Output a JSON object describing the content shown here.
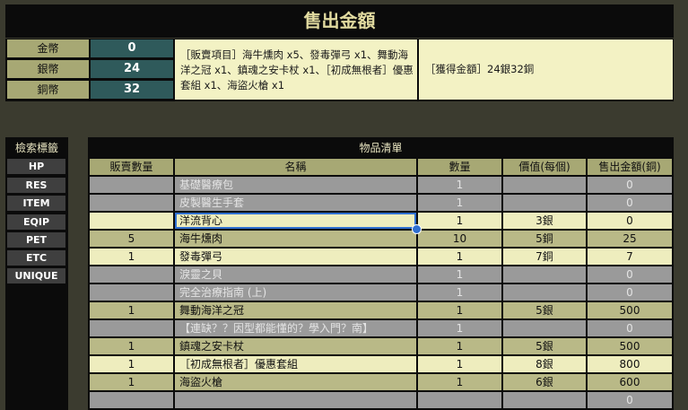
{
  "title": "售出金額",
  "coins": [
    {
      "label": "金幣",
      "value": "0"
    },
    {
      "label": "銀幣",
      "value": "24"
    },
    {
      "label": "銅幣",
      "value": "32"
    }
  ],
  "sold_items_text": "［販賣項目］海牛燻肉 x5、發毒彈弓 x1、舞動海洋之冠 x1、鎮魂之安卡杖 x1、［初成無根者］優惠套組 x1、海盜火槍 x1",
  "earned_text": "［獲得金額］24銀32銅",
  "sidebar": {
    "title": "檢索標籤",
    "buttons": [
      "HP",
      "RES",
      "ITEM",
      "EQIP",
      "PET",
      "ETC",
      "UNIQUE"
    ]
  },
  "table": {
    "title": "物品清單",
    "headers": [
      "販賣數量",
      "名稱",
      "數量",
      "價值(每個)",
      "售出金額(銅)"
    ],
    "rows": [
      {
        "sell": "",
        "name": "基礎醫療包",
        "qty": "1",
        "price": "",
        "total": "0",
        "style": "gray"
      },
      {
        "sell": "",
        "name": "皮製醫生手套",
        "qty": "1",
        "price": "",
        "total": "0",
        "style": "gray"
      },
      {
        "sell": "",
        "name": "洋流背心",
        "qty": "1",
        "price": "3銀",
        "total": "0",
        "style": "lite"
      },
      {
        "sell": "5",
        "name": "海牛燻肉",
        "qty": "10",
        "price": "5銅",
        "total": "25",
        "style": "olive"
      },
      {
        "sell": "1",
        "name": "發毒彈弓",
        "qty": "1",
        "price": "7銅",
        "total": "7",
        "style": "lite"
      },
      {
        "sell": "",
        "name": "淚靈之貝",
        "qty": "1",
        "price": "",
        "total": "0",
        "style": "gray"
      },
      {
        "sell": "",
        "name": "完全治療指南 (上)",
        "qty": "1",
        "price": "",
        "total": "0",
        "style": "gray"
      },
      {
        "sell": "1",
        "name": "舞動海洋之冠",
        "qty": "1",
        "price": "5銀",
        "total": "500",
        "style": "olive"
      },
      {
        "sell": "",
        "name": "【連缺？？因型都能懂的？學入門？南】",
        "qty": "1",
        "price": "",
        "total": "0",
        "style": "gray"
      },
      {
        "sell": "1",
        "name": "鎮魂之安卡杖",
        "qty": "1",
        "price": "5銀",
        "total": "500",
        "style": "olive"
      },
      {
        "sell": "1",
        "name": "［初成無根者］優惠套組",
        "qty": "1",
        "price": "8銀",
        "total": "800",
        "style": "lite"
      },
      {
        "sell": "1",
        "name": "海盜火槍",
        "qty": "1",
        "price": "6銀",
        "total": "600",
        "style": "olive"
      },
      {
        "sell": "",
        "name": "",
        "qty": "",
        "price": "",
        "total": "0",
        "style": "gray"
      }
    ]
  }
}
